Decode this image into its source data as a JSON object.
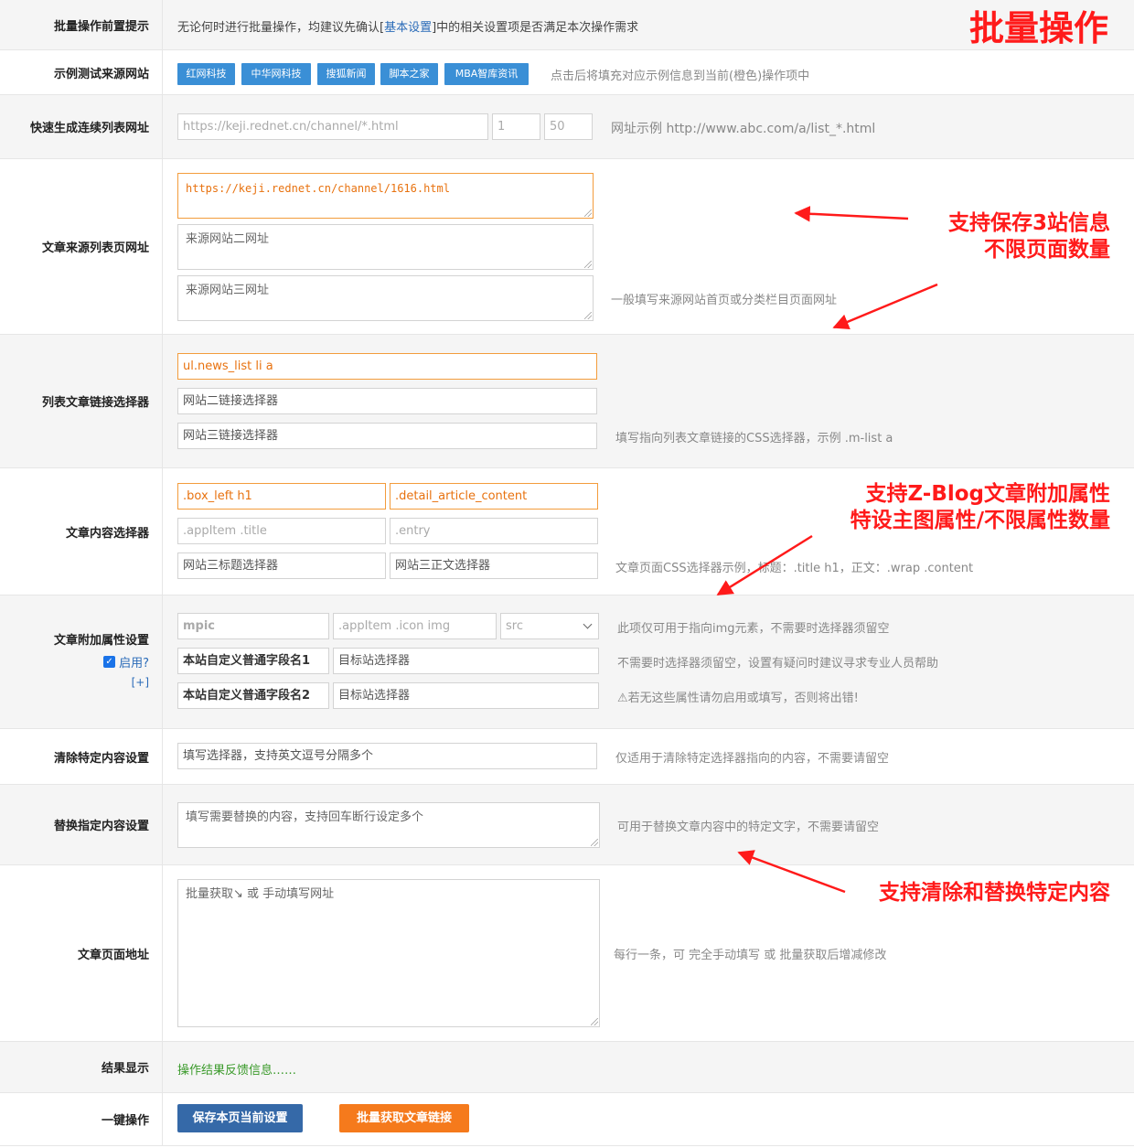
{
  "title_big": "批量操作",
  "rows": {
    "pre_tip": {
      "label": "批量操作前置提示",
      "text_a": "无论何时进行批量操作，均建议先确认[",
      "link": "基本设置",
      "text_b": "]中的相关设置项是否满足本次操作需求"
    },
    "sample_source": {
      "label": "示例测试来源网站",
      "tags": [
        "红网科技",
        "中华网科技",
        "搜狐新闻",
        "脚本之家",
        "MBA智库资讯"
      ],
      "hint": "点击后将填充对应示例信息到当前(橙色)操作项中"
    },
    "quick_list": {
      "label": "快速生成连续列表网址",
      "url_placeholder": "https://keji.rednet.cn/channel/*.html",
      "start": "1",
      "end": "50",
      "hint": "网址示例 http://www.abc.com/a/list_*.html"
    },
    "list_urls": {
      "label": "文章来源列表页网址",
      "url1": "https://keji.rednet.cn/channel/1616.html",
      "url2_placeholder": "来源网站二网址",
      "url3_placeholder": "来源网站三网址",
      "hint": "一般填写来源网站首页或分类栏目页面网址"
    },
    "link_selector": {
      "label": "列表文章链接选择器",
      "sel1": "ul.news_list li a",
      "sel2_placeholder": "网站二链接选择器",
      "sel3_placeholder": "网站三链接选择器",
      "hint": "填写指向列表文章链接的CSS选择器，示例 .m-list a"
    },
    "content_selector": {
      "label": "文章内容选择器",
      "title1": ".box_left h1",
      "body1": ".detail_article_content",
      "title2": ".appItem .title",
      "body2": ".entry",
      "title3_placeholder": "网站三标题选择器",
      "body3_placeholder": "网站三正文选择器",
      "hint": "文章页面CSS选择器示例，标题：.title h1，正文：.wrap .content"
    },
    "extra_attr": {
      "label": "文章附加属性设置",
      "enable_label": "启用?",
      "add_label": "[+]",
      "field1": "mpic",
      "sel1": ".appItem .icon img",
      "attr1": "src",
      "field2": "本站自定义普通字段名1",
      "sel2_placeholder": "目标站选择器",
      "field3": "本站自定义普通字段名2",
      "sel3_placeholder": "目标站选择器",
      "hint1": "此项仅可用于指向img元素，不需要时选择器须留空",
      "hint2": "不需要时选择器须留空，设置有疑问时建议寻求专业人员帮助",
      "hint3": "⚠若无这些属性请勿启用或填写，否则将出错!"
    },
    "clear_content": {
      "label": "清除特定内容设置",
      "placeholder": "填写选择器，支持英文逗号分隔多个",
      "hint": "仅适用于清除特定选择器指向的内容，不需要请留空"
    },
    "replace_content": {
      "label": "替换指定内容设置",
      "placeholder": "填写需要替换的内容，支持回车断行设定多个",
      "hint": "可用于替换文章内容中的特定文字，不需要请留空"
    },
    "article_urls": {
      "label": "文章页面地址",
      "placeholder": "批量获取↘ 或 手动填写网址",
      "hint": "每行一条，可 完全手动填写 或 批量获取后增减修改"
    },
    "result": {
      "label": "结果显示",
      "text": "操作结果反馈信息……"
    },
    "one_click": {
      "label": "一键操作",
      "save_btn": "保存本页当前设置",
      "fetch_btn": "批量获取文章链接"
    }
  },
  "annotations": {
    "a1_line1": "支持保存3站信息",
    "a1_line2": "不限页面数量",
    "a2_line1": "支持Z-Blog文章附加属性",
    "a2_line2": "特设主图属性/不限属性数量",
    "a3": "支持清除和替换特定内容"
  },
  "colors": {
    "accent_blue": "#3a8fd6",
    "orange": "#f39c3c",
    "save_btn": "#3569a8",
    "fetch_btn": "#f57a1c",
    "annotation_red": "#ff1a1a",
    "result_green": "#3a9a2a"
  }
}
